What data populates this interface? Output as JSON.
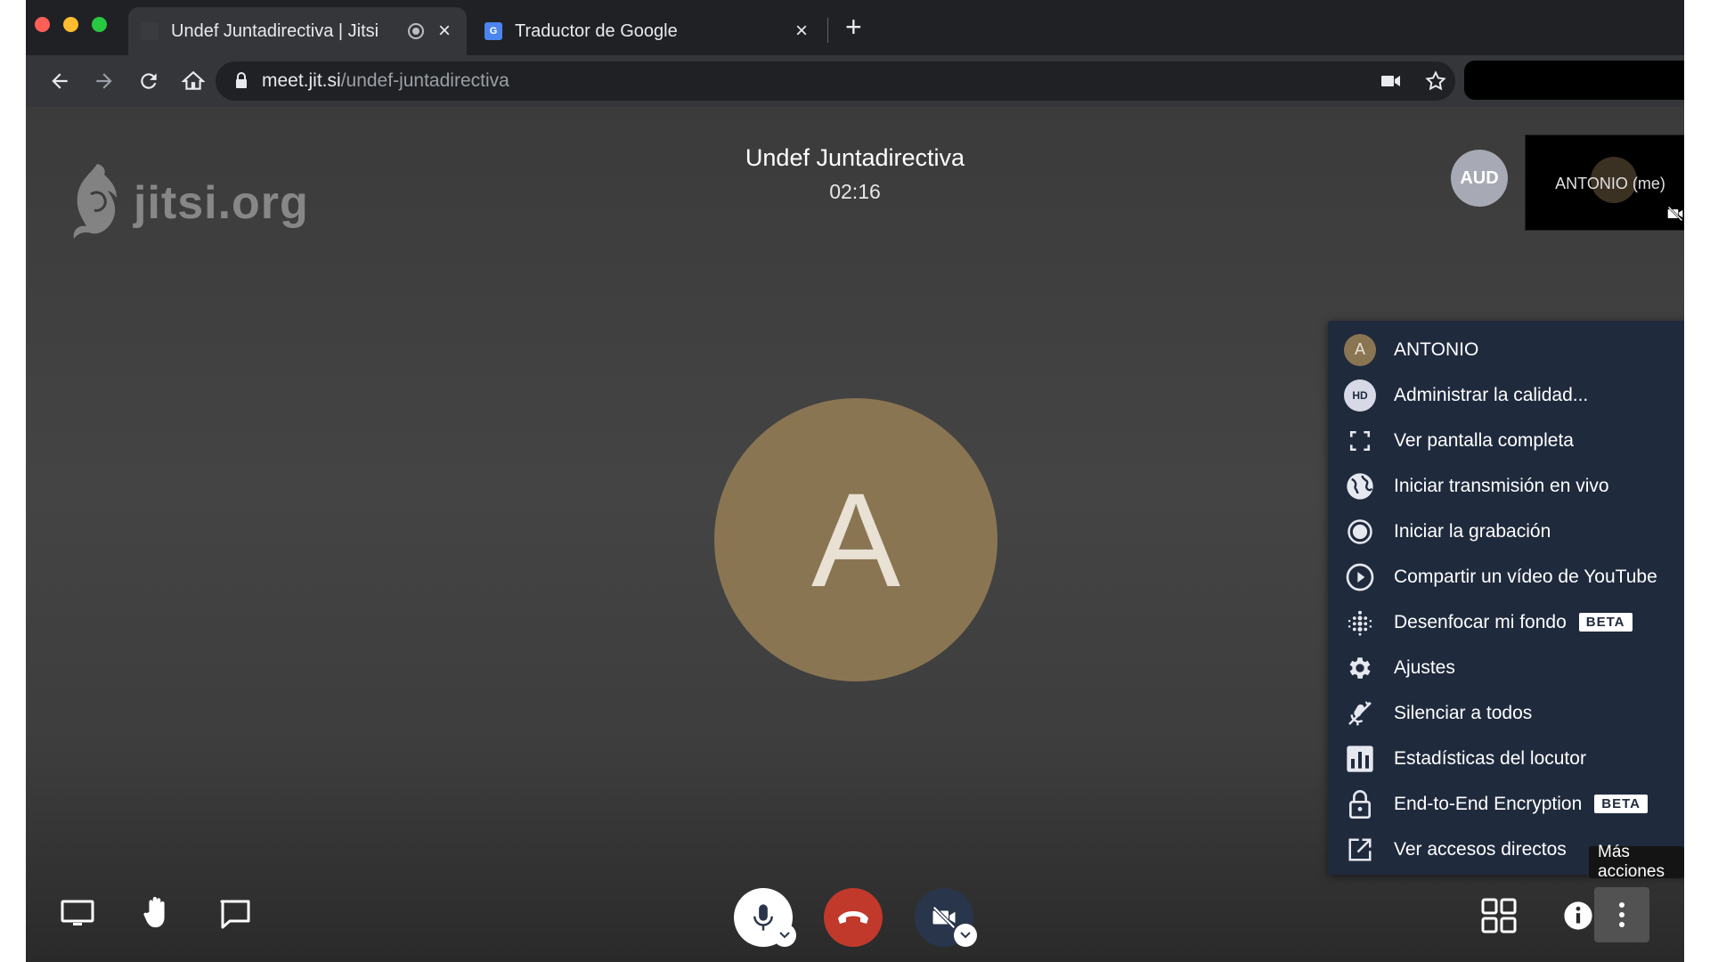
{
  "browser": {
    "tabs": [
      {
        "title": "Undef Juntadirectiva | Jitsi",
        "active": true,
        "icon": "jitsi-favicon"
      },
      {
        "title": "Traductor de Google",
        "active": false,
        "icon": "google-translate-favicon"
      }
    ],
    "favicon_gt_text": "G",
    "new_tab_label": "+",
    "close_label": "×",
    "url": {
      "host": "meet.jit.si",
      "path": "/undef-juntadirectiva"
    }
  },
  "conference": {
    "watermark": "jitsi.org",
    "title": "Undef Juntadirectiva",
    "timer": "02:16",
    "remote_avatar_initials": "AUD",
    "local_thumbnail_name": "ANTONIO (me)",
    "main_avatar_letter": "A"
  },
  "menu": {
    "items": [
      {
        "label": "ANTONIO",
        "icon": "avatar",
        "avatar_letter": "A"
      },
      {
        "label": "Administrar la calidad...",
        "icon": "hd-icon",
        "badge_text": "HD"
      },
      {
        "label": "Ver pantalla completa",
        "icon": "fullscreen-icon"
      },
      {
        "label": "Iniciar transmisión en vivo",
        "icon": "globe-icon"
      },
      {
        "label": "Iniciar la grabación",
        "icon": "record-icon"
      },
      {
        "label": "Compartir un vídeo de YouTube",
        "icon": "play-circle-icon"
      },
      {
        "label": "Desenfocar mi fondo",
        "icon": "blur-icon",
        "badge": "BETA"
      },
      {
        "label": "Ajustes",
        "icon": "gear-icon"
      },
      {
        "label": "Silenciar a todos",
        "icon": "mic-mute-all-icon"
      },
      {
        "label": "Estadísticas del locutor",
        "icon": "stats-icon"
      },
      {
        "label": "End-to-End Encryption",
        "icon": "lock-icon",
        "badge": "BETA"
      },
      {
        "label": "Ver accesos directos",
        "icon": "open-external-icon"
      }
    ]
  },
  "tooltip": "Más acciones",
  "colors": {
    "stage": "#444444",
    "menu_bg": "#1f2a3d",
    "avatar": "#8a7553",
    "hangup": "#c0392b"
  }
}
